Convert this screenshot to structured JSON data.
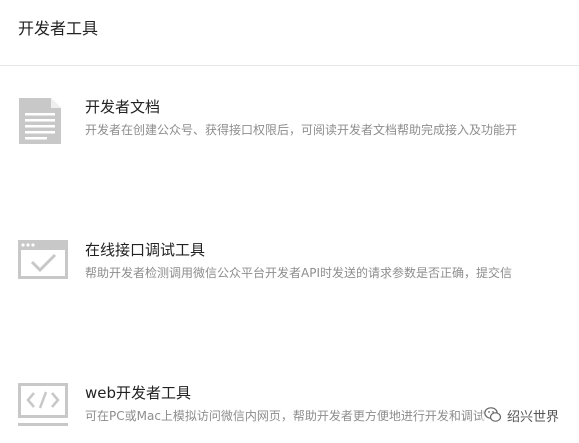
{
  "header": {
    "title": "开发者工具"
  },
  "tools": [
    {
      "title": "开发者文档",
      "description": "开发者在创建公众号、获得接口权限后，可阅读开发者文档帮助完成接入及功能开",
      "icon": "document-icon"
    },
    {
      "title": "在线接口调试工具",
      "description": "帮助开发者检测调用微信公众平台开发者API时发送的请求参数是否正确，提交信",
      "icon": "browser-check-icon"
    },
    {
      "title": "web开发者工具",
      "description": "可在PC或Mac上模拟访问微信内网页，帮助开发者更方便地进行开发和调试",
      "icon": "code-window-icon"
    }
  ],
  "watermark": {
    "text": "绍兴世界",
    "icon": "wechat-logo-icon"
  },
  "colors": {
    "icon_gray": "#c8c8c8",
    "text_dark": "#222222",
    "text_muted": "#8d8d8d",
    "divider": "#e7e7eb"
  }
}
